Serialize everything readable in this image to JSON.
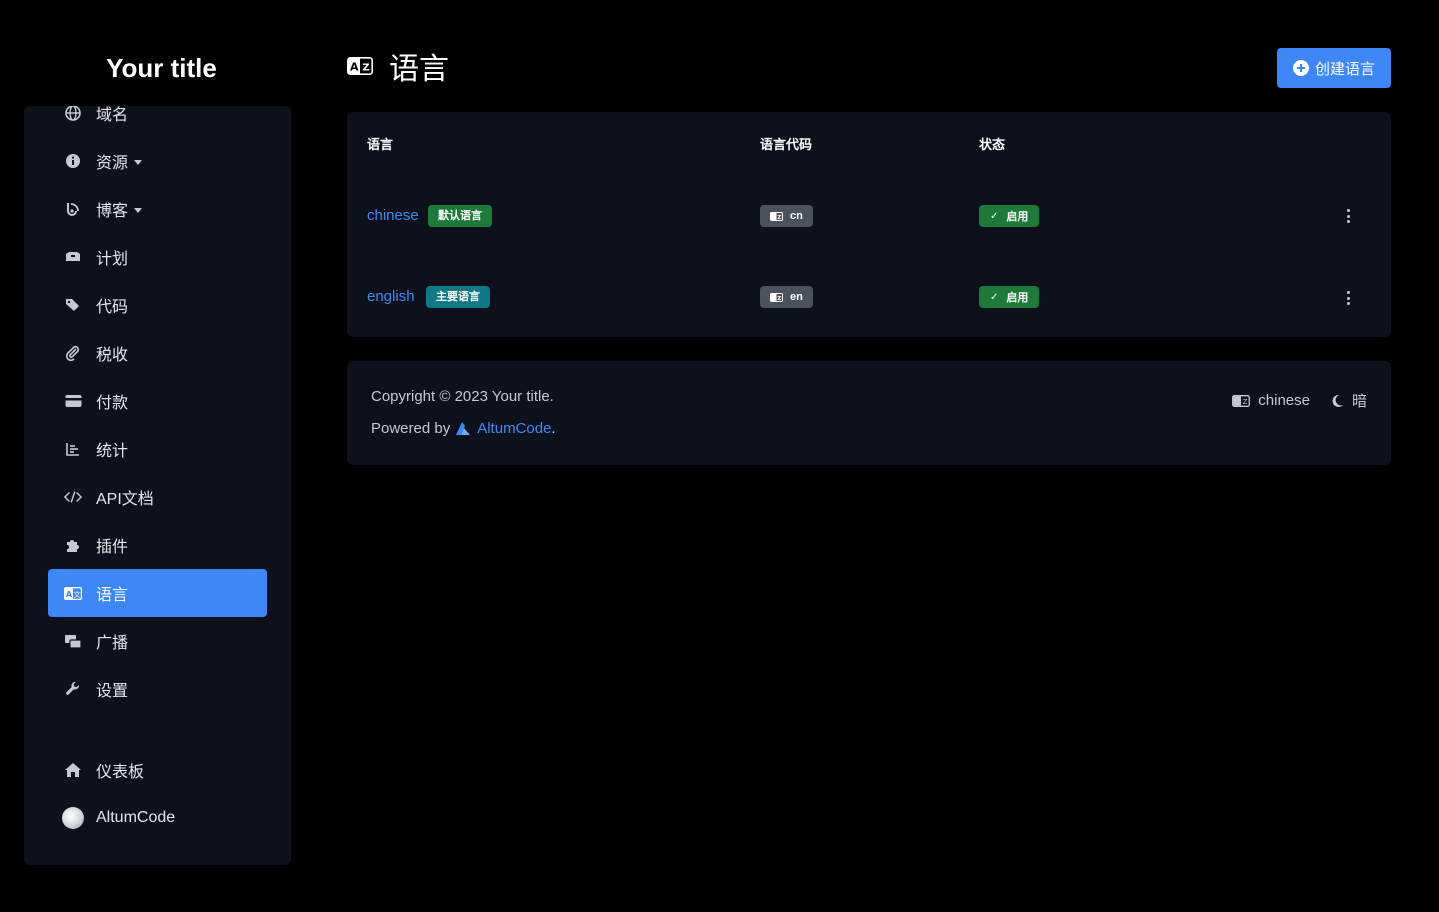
{
  "brand": {
    "title": "Your title"
  },
  "sidebar": {
    "items": [
      {
        "label": "域名",
        "icon": "globe-icon"
      },
      {
        "label": "资源",
        "icon": "info-icon",
        "dropdown": true
      },
      {
        "label": "博客",
        "icon": "blog-icon",
        "dropdown": true
      },
      {
        "label": "计划",
        "icon": "box-icon"
      },
      {
        "label": "代码",
        "icon": "tags-icon"
      },
      {
        "label": "税收",
        "icon": "paperclip-icon"
      },
      {
        "label": "付款",
        "icon": "credit-card-icon"
      },
      {
        "label": "统计",
        "icon": "chart-icon"
      },
      {
        "label": "API文档",
        "icon": "code-icon"
      },
      {
        "label": "插件",
        "icon": "puzzle-icon"
      },
      {
        "label": "语言",
        "icon": "language-icon",
        "active": true
      },
      {
        "label": "广播",
        "icon": "broadcast-icon"
      },
      {
        "label": "设置",
        "icon": "wrench-icon"
      }
    ],
    "bottom": [
      {
        "label": "仪表板",
        "icon": "home-icon"
      },
      {
        "label": "AltumCode",
        "icon": "avatar"
      }
    ]
  },
  "header": {
    "title": "语言",
    "icon": "language-icon",
    "create_label": "创建语言"
  },
  "table": {
    "headers": [
      "语言",
      "语言代码",
      "状态"
    ],
    "rows": [
      {
        "name": "chinese",
        "badge": "默认语言",
        "badge_color": "#1e7a3a",
        "code": "cn",
        "status": "启用"
      },
      {
        "name": "english",
        "badge": "主要语言",
        "badge_color": "#117886",
        "code": "en",
        "status": "启用"
      }
    ]
  },
  "footer": {
    "copyright": "Copyright © 2023 Your title.",
    "powered_prefix": "Powered by",
    "powered_brand": "AltumCode",
    "powered_suffix": ".",
    "language": "chinese",
    "theme": "暗"
  },
  "colors": {
    "accent": "#3f86f7",
    "success": "#1e7a3a",
    "info": "#117886",
    "card": "#0c111c",
    "background": "#000000"
  }
}
